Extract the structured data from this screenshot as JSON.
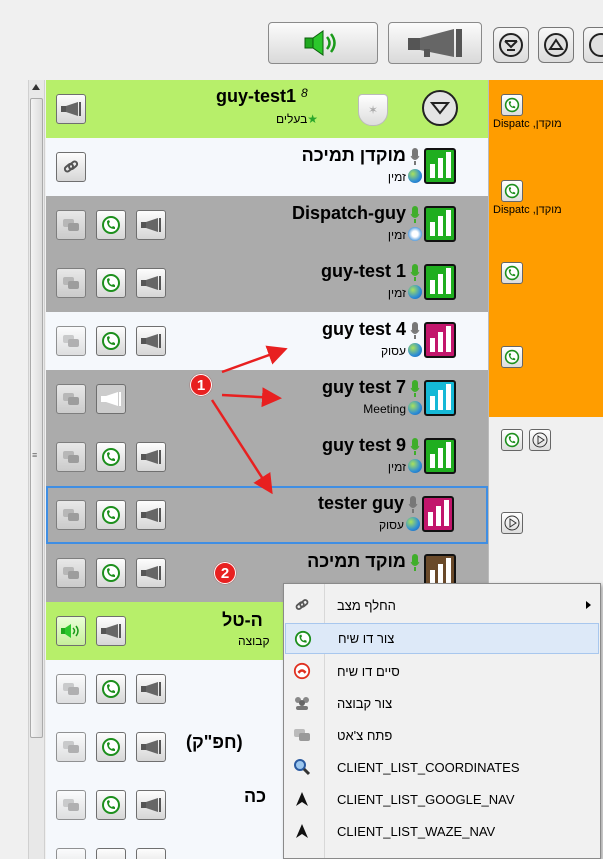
{
  "toolbar": {
    "speaker_icon": "speaker-on-icon",
    "megaphone_icon": "megaphone-icon",
    "round_icons": [
      "filter-icon",
      "triangle-up-icon",
      "circle-icon"
    ]
  },
  "group_header": {
    "name": "guy-test1",
    "count": "8",
    "role": "בעלים",
    "star_icon": "star-icon",
    "shield_icon": "shield-icon",
    "collapse_icon": "chevron-down-circle-icon"
  },
  "rows": [
    {
      "name": "מוקדן תמיכה",
      "status": "זמין",
      "signal_color": "#1fae1f",
      "row_style": "light",
      "mic": "gray"
    },
    {
      "name": "Dispatch-guy",
      "status": "זמין",
      "signal_color": "#1fae1f",
      "row_style": "gray",
      "mic": "green"
    },
    {
      "name": "guy-test 1",
      "status": "זמין",
      "signal_color": "#1fae1f",
      "row_style": "gray",
      "mic": "green"
    },
    {
      "name": "guy test 4",
      "status": "עסוק",
      "signal_color": "#c2166c",
      "row_style": "light",
      "mic": "gray"
    },
    {
      "name": "guy test 7",
      "status": "Meeting",
      "signal_color": "#15b8d6",
      "row_style": "gray",
      "mic": "green"
    },
    {
      "name": "guy test 9",
      "status": "זמין",
      "signal_color": "#1fae1f",
      "row_style": "gray",
      "mic": "green"
    },
    {
      "name": "tester guy",
      "status": "עסוק",
      "signal_color": "#c2166c",
      "row_style": "selected",
      "mic": "gray"
    },
    {
      "name": "מוקד  תמיכה",
      "status": "",
      "signal_color": "#6a4a2a",
      "row_style": "gray",
      "mic": "green"
    }
  ],
  "group2": {
    "name": "ה-טל",
    "sub": "קבוצה"
  },
  "partial_rows": [
    "",
    "(חפ\"ק)",
    "כה",
    ""
  ],
  "right_panel": {
    "label": "מוקדן, Dispatc",
    "label2": "מוקדן, Dispatc"
  },
  "annotations": {
    "badge1": "1",
    "badge2": "2"
  },
  "context_menu": {
    "items": [
      {
        "label": "החלף מצב",
        "icon": "link-icon",
        "submenu": true
      },
      {
        "label": "צור דו שיח",
        "icon": "phone-icon",
        "highlight": true
      },
      {
        "label": "סיים דו שיח",
        "icon": "hangup-icon"
      },
      {
        "label": "צור קבוצה",
        "icon": "group-icon"
      },
      {
        "label": "פתח צ'אט",
        "icon": "chat-icon"
      },
      {
        "label": "CLIENT_LIST_COORDINATES",
        "icon": "magnifier-icon"
      },
      {
        "label": "CLIENT_LIST_GOOGLE_NAV",
        "icon": "navigation-arrow-icon"
      },
      {
        "label": "CLIENT_LIST_WAZE_NAV",
        "icon": "navigation-arrow-icon"
      }
    ]
  }
}
